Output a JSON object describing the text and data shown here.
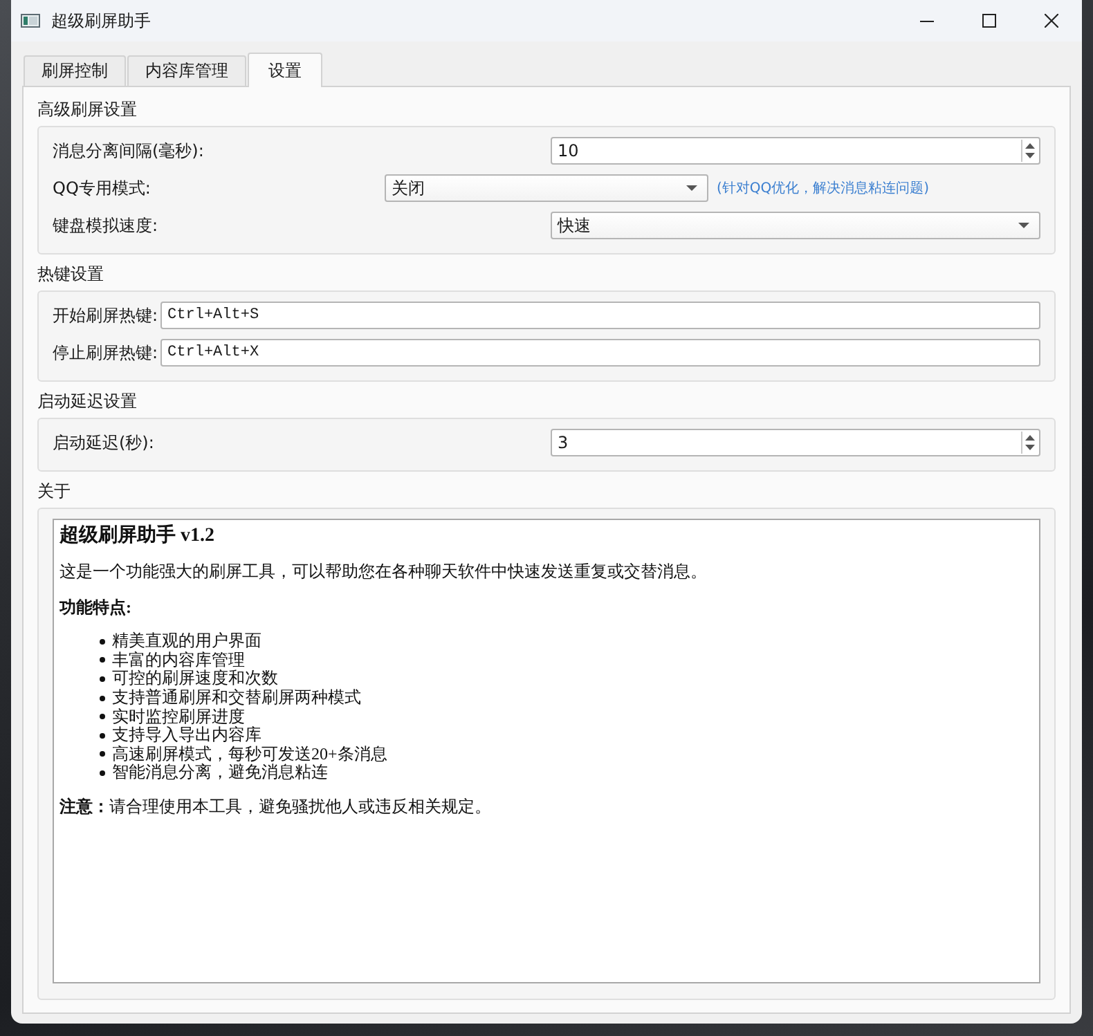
{
  "window": {
    "title": "超级刷屏助手"
  },
  "tabs": [
    {
      "label": "刷屏控制",
      "selected": false
    },
    {
      "label": "内容库管理",
      "selected": false
    },
    {
      "label": "设置",
      "selected": true
    }
  ],
  "sections": [
    {
      "title": "高级刷屏设置",
      "rows": [
        {
          "kind": "spinbox",
          "label": "消息分离间隔(毫秒):",
          "value": "10"
        },
        {
          "kind": "combobox",
          "label": "QQ专用模式:",
          "value": "关闭",
          "hint": "(针对QQ优化，解决消息粘连问题)"
        },
        {
          "kind": "combobox",
          "label": "键盘模拟速度:",
          "value": "快速"
        }
      ]
    },
    {
      "title": "热键设置",
      "rows": [
        {
          "kind": "text",
          "label": "开始刷屏热键:",
          "value": "Ctrl+Alt+S"
        },
        {
          "kind": "text",
          "label": "停止刷屏热键:",
          "value": "Ctrl+Alt+X"
        }
      ]
    },
    {
      "title": "启动延迟设置",
      "rows": [
        {
          "kind": "spinbox",
          "label": "启动延迟(秒):",
          "value": "3"
        }
      ]
    },
    {
      "title": "关于",
      "about": {
        "heading": "超级刷屏助手 v1.2",
        "intro": "这是一个功能强大的刷屏工具，可以帮助您在各种聊天软件中快速发送重复或交替消息。",
        "features_title": "功能特点:",
        "features": [
          "精美直观的用户界面",
          "丰富的内容库管理",
          "可控的刷屏速度和次数",
          "支持普通刷屏和交替刷屏两种模式",
          "实时监控刷屏进度",
          "支持导入导出内容库",
          "高速刷屏模式，每秒可发送20+条消息",
          "智能消息分离，避免消息粘连"
        ],
        "note": "**注意：**请合理使用本工具，避免骚扰他人或违反相关规定。"
      }
    }
  ]
}
